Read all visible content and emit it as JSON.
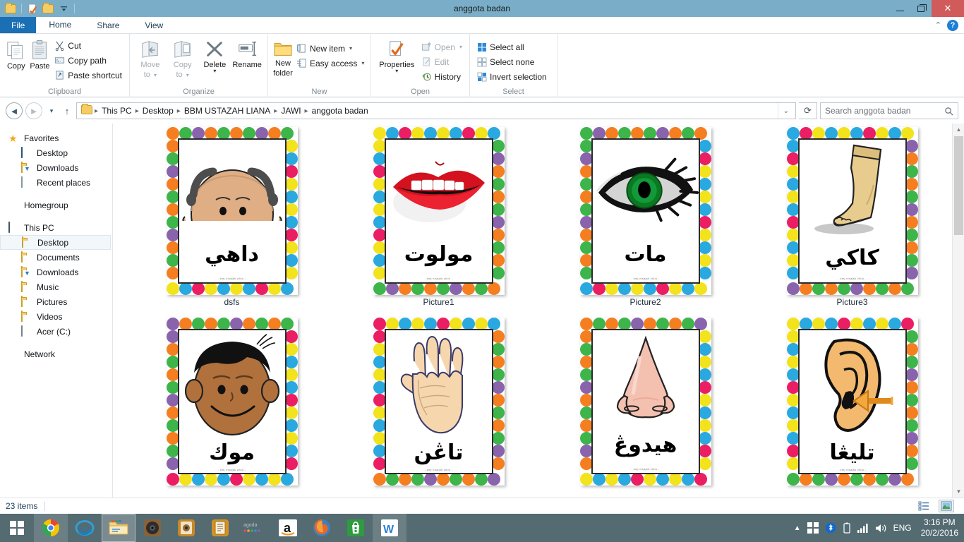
{
  "window": {
    "title": "anggota badan",
    "quick_access": [
      "folder-icon",
      "properties-icon",
      "new-folder-icon",
      "customize-caret-icon"
    ],
    "minimize": "minimize-icon",
    "maximize": "restore-icon",
    "close": "close-icon"
  },
  "tabs": {
    "file": "File",
    "items": [
      "Home",
      "Share",
      "View"
    ],
    "active": "Home",
    "collapse_ribbon": "chevron-up-icon",
    "help": "?"
  },
  "ribbon": {
    "groups": [
      {
        "label": "Clipboard",
        "big_buttons": [
          {
            "label_line1": "Copy",
            "label_line2": "",
            "icon": "copy-icon",
            "dim": false
          },
          {
            "label_line1": "Paste",
            "label_line2": "",
            "icon": "paste-icon",
            "dim": false
          }
        ],
        "small_buttons": [
          {
            "label": "Cut",
            "icon": "scissors-icon",
            "dim": false
          },
          {
            "label": "Copy path",
            "icon": "copy-path-icon",
            "dim": false
          },
          {
            "label": "Paste shortcut",
            "icon": "paste-shortcut-icon",
            "dim": false
          }
        ]
      },
      {
        "label": "Organize",
        "big_buttons": [
          {
            "label_line1": "Move",
            "label_line2": "to",
            "icon": "move-to-icon",
            "dim": true,
            "caret": true
          },
          {
            "label_line1": "Copy",
            "label_line2": "to",
            "icon": "copy-to-icon",
            "dim": true,
            "caret": true
          },
          {
            "label_line1": "Delete",
            "label_line2": "",
            "icon": "delete-icon",
            "dim": false,
            "caret": true
          },
          {
            "label_line1": "Rename",
            "label_line2": "",
            "icon": "rename-icon",
            "dim": false,
            "caret": false
          }
        ],
        "small_buttons": []
      },
      {
        "label": "New",
        "big_buttons": [
          {
            "label_line1": "New",
            "label_line2": "folder",
            "icon": "new-folder-icon",
            "dim": false
          }
        ],
        "small_buttons": [
          {
            "label": "New item",
            "icon": "new-item-icon",
            "dim": false,
            "caret": true
          },
          {
            "label": "Easy access",
            "icon": "easy-access-icon",
            "dim": false,
            "caret": true
          }
        ]
      },
      {
        "label": "Open",
        "big_buttons": [
          {
            "label_line1": "Properties",
            "label_line2": "",
            "icon": "properties-icon",
            "dim": false,
            "caret": true
          }
        ],
        "small_buttons": [
          {
            "label": "Open",
            "icon": "open-icon",
            "dim": true,
            "caret": true
          },
          {
            "label": "Edit",
            "icon": "edit-icon",
            "dim": true
          },
          {
            "label": "History",
            "icon": "history-icon",
            "dim": false
          }
        ]
      },
      {
        "label": "Select",
        "big_buttons": [],
        "small_buttons": [
          {
            "label": "Select all",
            "icon": "select-all-icon",
            "dim": false
          },
          {
            "label": "Select none",
            "icon": "select-none-icon",
            "dim": false
          },
          {
            "label": "Invert selection",
            "icon": "invert-selection-icon",
            "dim": false
          }
        ]
      }
    ]
  },
  "addressbar": {
    "back": "back-icon",
    "forward": "forward-icon",
    "recent": "recent-dropdown-icon",
    "up": "up-icon",
    "folder_icon": "folder-icon",
    "crumbs": [
      "This PC",
      "Desktop",
      "BBM USTAZAH LIANA",
      "JAWI",
      "anggota badan"
    ],
    "dropdown": "chevron-down-icon",
    "refresh": "refresh-icon"
  },
  "search": {
    "placeholder": "Search anggota badan",
    "value": "",
    "icon": "search-icon"
  },
  "sidebar": {
    "sections": [
      {
        "header": {
          "label": "Favorites",
          "icon": "star-icon"
        },
        "items": [
          {
            "label": "Desktop",
            "icon": "desktop-icon"
          },
          {
            "label": "Downloads",
            "icon": "downloads-folder-icon"
          },
          {
            "label": "Recent places",
            "icon": "recent-places-icon"
          }
        ]
      },
      {
        "header": {
          "label": "Homegroup",
          "icon": "homegroup-icon"
        },
        "items": []
      },
      {
        "header": {
          "label": "This PC",
          "icon": "this-pc-icon"
        },
        "items": [
          {
            "label": "Desktop",
            "icon": "desktop-folder-icon",
            "selected": true
          },
          {
            "label": "Documents",
            "icon": "documents-folder-icon"
          },
          {
            "label": "Downloads",
            "icon": "downloads-folder-icon"
          },
          {
            "label": "Music",
            "icon": "music-folder-icon"
          },
          {
            "label": "Pictures",
            "icon": "pictures-folder-icon"
          },
          {
            "label": "Videos",
            "icon": "videos-folder-icon"
          },
          {
            "label": "Acer (C:)",
            "icon": "drive-icon"
          }
        ]
      },
      {
        "header": {
          "label": "Network",
          "icon": "network-icon"
        },
        "items": []
      }
    ]
  },
  "files": {
    "items": [
      {
        "name": "dsfs",
        "word": "داهي",
        "picture": "head-icon",
        "footer": "- kmj nisajkk zikiu -"
      },
      {
        "name": "Picture1",
        "word": "مولوت",
        "picture": "lips-icon",
        "footer": "- kmj nisajkk zikiu -"
      },
      {
        "name": "Picture2",
        "word": "مات",
        "picture": "eye-icon",
        "footer": "- kmj nisajkk zikiu -"
      },
      {
        "name": "Picture3",
        "word": "كاكي",
        "picture": "leg-icon",
        "footer": "- kmj nisajkk zikiu -"
      },
      {
        "name": "",
        "word": "موك",
        "picture": "face-icon",
        "footer": "- kmj nisajkk zikiu -"
      },
      {
        "name": "",
        "word": "تاڠن",
        "picture": "hand-icon",
        "footer": "- kmj nisajkk zikiu -"
      },
      {
        "name": "",
        "word": "هيدوڠ",
        "picture": "nose-icon",
        "footer": "- kmj nisajkk zikiu -"
      },
      {
        "name": "",
        "word": "تليڠا",
        "picture": "ear-icon",
        "footer": "- kmj nisajkk zikiu -"
      }
    ],
    "bead_colors": [
      "#f57f20",
      "#f2e31c",
      "#3db54a",
      "#2aa9e0",
      "#8a63ad",
      "#ec1e63",
      "#f57f20",
      "#f2e31c",
      "#3db54a",
      "#2aa9e0"
    ]
  },
  "statusbar": {
    "item_count": "23 items",
    "details_view": "details-view-icon",
    "large_icons_view": "large-icons-view-icon"
  },
  "taskbar": {
    "start": "windows-start-icon",
    "items": [
      {
        "name": "chrome-taskbar-icon",
        "state": "running"
      },
      {
        "name": "internet-explorer-taskbar-icon",
        "state": "pinned"
      },
      {
        "name": "file-explorer-taskbar-icon",
        "state": "open"
      },
      {
        "name": "speaker-app-taskbar-icon",
        "state": "pinned"
      },
      {
        "name": "media-app-taskbar-icon",
        "state": "pinned"
      },
      {
        "name": "notes-app-taskbar-icon",
        "state": "pinned"
      },
      {
        "name": "agoda-taskbar-icon",
        "state": "pinned"
      },
      {
        "name": "amazon-taskbar-icon",
        "state": "pinned"
      },
      {
        "name": "firefox-taskbar-icon",
        "state": "pinned"
      },
      {
        "name": "store-taskbar-icon",
        "state": "pinned"
      },
      {
        "name": "wps-writer-taskbar-icon",
        "state": "running"
      }
    ],
    "tray": {
      "show_hidden": "show-hidden-icons-icon",
      "action_center": "action-center-icon",
      "bluetooth": "bluetooth-icon",
      "battery": "battery-icon",
      "network": "signal-bars-icon",
      "volume": "volume-icon",
      "language": "ENG",
      "time": "3:16 PM",
      "date": "20/2/2016"
    }
  },
  "colors": {
    "titlebar": "#7aaec8",
    "file_tab": "#1a6fb5",
    "close_button": "#d15b5b",
    "taskbar": "#546b72",
    "selection": "#f2f7fb"
  }
}
